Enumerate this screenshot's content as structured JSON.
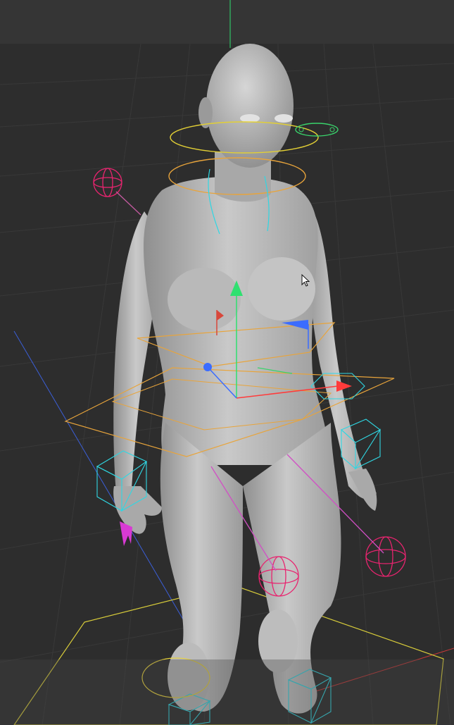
{
  "viewport": {
    "name": "3D viewport",
    "background": "#2d2d2d",
    "grid_color": "#3a3a3a",
    "model": "female-base-mesh",
    "rig_colors": {
      "ik_controls": "#e8246f",
      "fk_rings": "#e8a43b",
      "head_ring": "#e8d23b",
      "eye_target": "#39d36b",
      "cubes": "#2fd7e3",
      "axis_y": "#2fe070",
      "axis_x": "#ff3b3b",
      "axis_z": "#3b6cff",
      "root_square": "#e3d83a"
    }
  },
  "icons": {
    "cursor": "mouse-pointer-icon",
    "transform_gizmo": "move-gizmo-icon"
  }
}
